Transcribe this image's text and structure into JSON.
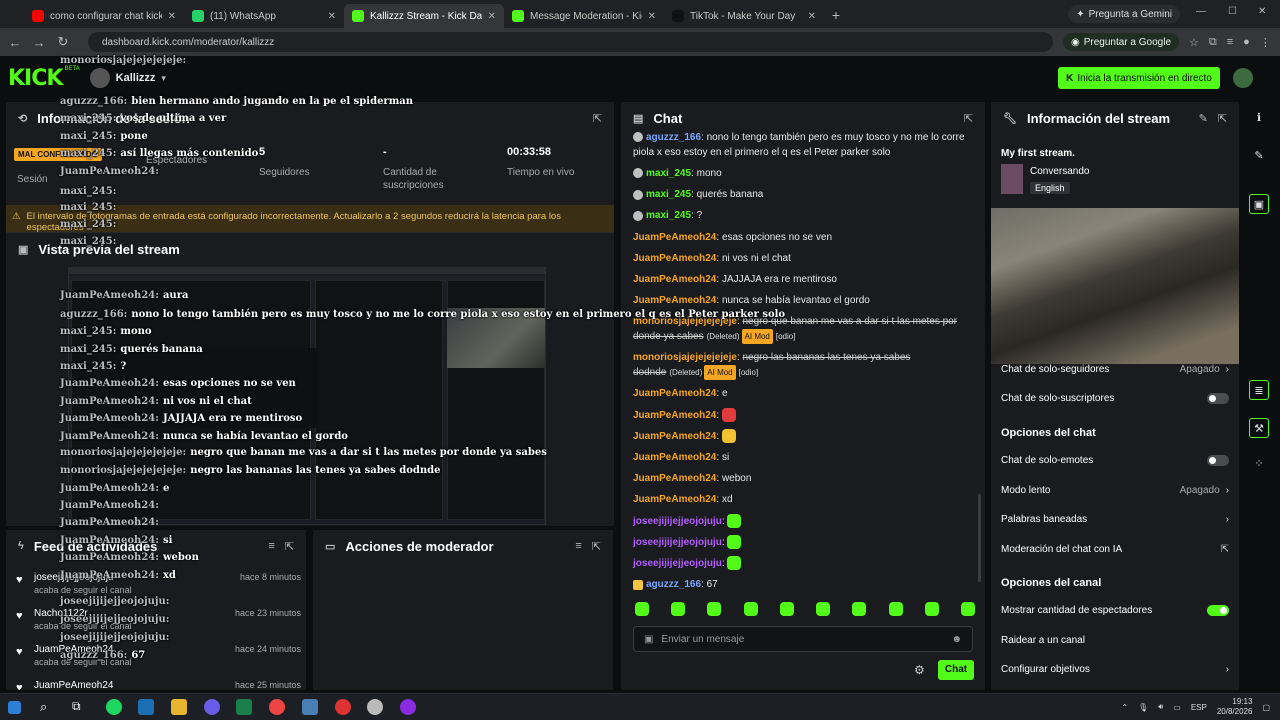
{
  "browser": {
    "tabs": [
      {
        "title": "como configurar chat kick para",
        "color": "#ff0000"
      },
      {
        "title": "(11) WhatsApp",
        "color": "#25d366"
      },
      {
        "title": "Kallizzz Stream - Kick Dashboa",
        "color": "#53fc18",
        "active": true
      },
      {
        "title": "Message Moderation - Kick Da",
        "color": "#53fc18"
      },
      {
        "title": "TikTok - Make Your Day",
        "color": "#111111"
      }
    ],
    "gemini": "Pregunta a Gemini",
    "url": "dashboard.kick.com/moderator/kallizzz",
    "ask_google": "Preguntar a Google"
  },
  "kick": {
    "logo": "KICK",
    "beta": "BETA",
    "username": "Kallizzz",
    "golive": "Inicia la transmisión en directo",
    "brand_color": "#53fc18"
  },
  "session": {
    "title": "Información de la sesión",
    "badge": "MAL CONFIGURADO",
    "label": "Sesión",
    "stats": [
      {
        "value": "",
        "label": "Espectadores"
      },
      {
        "value": "5",
        "label": "Seguidores"
      },
      {
        "value": "-",
        "label": "Cantidad de suscripciones"
      },
      {
        "value": "00:33:58",
        "label": "Tiempo en vivo"
      }
    ],
    "warning": "El intervalo de fotogramas de entrada está configurado incorrectamente. Actualizarlo a 2 segundos reducirá la latencia para los espectadores"
  },
  "preview": {
    "title": "Vista previa del stream"
  },
  "feed": {
    "title": "Feed de actividades",
    "items": [
      {
        "name": "joseejijijejjeojojuju",
        "action": "acaba de seguir el canal",
        "time": "hace 8 minutos"
      },
      {
        "name": "Nacho1122r",
        "action": "acaba de seguir el canal",
        "time": "hace 23 minutos"
      },
      {
        "name": "JuamPeAmeoh24",
        "action": "acaba de seguir el canal",
        "time": "hace 24 minutos"
      },
      {
        "name": "JuamPeAmeoh24",
        "action": "",
        "time": "hace 25 minutos"
      }
    ]
  },
  "mod": {
    "title": "Acciones de moderador"
  },
  "chat": {
    "title": "Chat",
    "messages": [
      {
        "user": "aguzzz_166",
        "color": "#7aa7ff",
        "text": "nono lo tengo también pero es muy tosco y no me lo corre piola x eso estoy en el primero el q es el Peter parker solo",
        "icon": "circ"
      },
      {
        "user": "maxi_245",
        "color": "#53fc18",
        "text": "mono",
        "icon": "circ"
      },
      {
        "user": "maxi_245",
        "color": "#53fc18",
        "text": "querés banana",
        "icon": "circ"
      },
      {
        "user": "maxi_245",
        "color": "#53fc18",
        "text": "?",
        "icon": "circ"
      },
      {
        "user": "JuamPeAmeoh24",
        "color": "#f5a623",
        "text": "esas opciones no se ven"
      },
      {
        "user": "JuamPeAmeoh24",
        "color": "#f5a623",
        "text": "ni vos ni el chat"
      },
      {
        "user": "JuamPeAmeoh24",
        "color": "#f5a623",
        "text": "JAJJAJA era re mentiroso"
      },
      {
        "user": "JuamPeAmeoh24",
        "color": "#f5a623",
        "text": "nunca se había levantao el gordo"
      },
      {
        "user": "monoriosjajejejejejeje",
        "color": "#f5a623",
        "text": "negro que banan me vas a dar si t las metes por donde ya sabes",
        "deleted": "(Deleted)",
        "mod": "AI Mod",
        "tag": "[odio]"
      },
      {
        "user": "monoriosjajejejejejeje",
        "color": "#f5a623",
        "text": "negro las bananas las tenes ya sabes dodnde",
        "deleted": "(Deleted)",
        "mod": "AI Mod",
        "tag": "[odio]"
      },
      {
        "user": "JuamPeAmeoh24",
        "color": "#f5a623",
        "text": "e"
      },
      {
        "user": "JuamPeAmeoh24",
        "color": "#f5a623",
        "text": "",
        "emote": "red"
      },
      {
        "user": "JuamPeAmeoh24",
        "color": "#f5a623",
        "text": "",
        "emote": "yellow"
      },
      {
        "user": "JuamPeAmeoh24",
        "color": "#f5a623",
        "text": "si"
      },
      {
        "user": "JuamPeAmeoh24",
        "color": "#f5a623",
        "text": "webon"
      },
      {
        "user": "JuamPeAmeoh24",
        "color": "#f5a623",
        "text": "xd"
      },
      {
        "user": "joseejijijejjeojojuju",
        "color": "#b45cff",
        "text": "",
        "emote": "green"
      },
      {
        "user": "joseejijijejjeojojuju",
        "color": "#b45cff",
        "text": "",
        "emote": "green"
      },
      {
        "user": "joseejijijejjeojojuju",
        "color": "#b45cff",
        "text": "",
        "emote": "green"
      },
      {
        "user": "aguzzz_166",
        "color": "#7aa7ff",
        "text": "67",
        "icon": "sq"
      }
    ],
    "input_placeholder": "Enviar un mensaje",
    "send": "Chat"
  },
  "stream_info": {
    "title": "Información del stream",
    "stream_title": "My first stream.",
    "category": "Conversando",
    "language": "English",
    "rows": [
      {
        "label": "Chat de solo-seguidores",
        "value": "Apagado",
        "kind": "chevron"
      },
      {
        "label": "Chat de solo-suscriptores",
        "kind": "toggle",
        "on": false
      }
    ],
    "chat_options_title": "Opciones del chat",
    "chat_options": [
      {
        "label": "Chat de solo-emotes",
        "kind": "toggle",
        "on": false
      },
      {
        "label": "Modo lento",
        "value": "Apagado",
        "kind": "chevron"
      },
      {
        "label": "Palabras baneadas",
        "kind": "chevron"
      },
      {
        "label": "Moderación del chat con IA",
        "kind": "external"
      }
    ],
    "channel_options_title": "Opciones del canal",
    "channel_options": [
      {
        "label": "Mostrar cantidad de espectadores",
        "kind": "toggle",
        "on": true
      },
      {
        "label": "Raidear a un canal",
        "kind": "none"
      },
      {
        "label": "Configurar objetivos",
        "kind": "chevron"
      }
    ]
  },
  "overlay": [
    {
      "user": "monoriosjajejejejejeje:",
      "text": ""
    },
    {
      "user": "aguzzz_166:",
      "text": "bien hermano ando jugando en la pe el spiderman"
    },
    {
      "user": "maxi_245:",
      "text": "vos de ultima a ver"
    },
    {
      "user": "maxi_245:",
      "text": "pone"
    },
    {
      "user": "maxi_245:",
      "text": "así llegas más contenido"
    },
    {
      "user": "JuamPeAmeoh24:",
      "text": ""
    },
    {
      "user": "maxi_245:",
      "text": ""
    },
    {
      "user": "maxi_245:",
      "text": ""
    },
    {
      "user": "maxi_245:",
      "text": ""
    },
    {
      "user": "maxi_245:",
      "text": ""
    },
    {
      "user": "JuamPeAmeoh24:",
      "text": "aura"
    },
    {
      "user": "aguzzz_166:",
      "text": "nono lo tengo también pero es muy tosco y no me lo corre piola x eso estoy en el primero el q es el Peter parker solo"
    },
    {
      "user": "maxi_245:",
      "text": "mono"
    },
    {
      "user": "maxi_245:",
      "text": "querés banana"
    },
    {
      "user": "maxi_245:",
      "text": "?"
    },
    {
      "user": "JuamPeAmeoh24:",
      "text": "esas opciones no se ven"
    },
    {
      "user": "JuamPeAmeoh24:",
      "text": "ni vos ni el chat"
    },
    {
      "user": "JuamPeAmeoh24:",
      "text": "JAJJAJA era re mentiroso"
    },
    {
      "user": "JuamPeAmeoh24:",
      "text": "nunca se había levantao el gordo"
    },
    {
      "user": "monoriosjajejejejejeje:",
      "text": "negro que banan me vas a dar si t las metes por donde ya sabes"
    },
    {
      "user": "monoriosjajejejejejeje:",
      "text": "negro las bananas las tenes ya sabes dodnde"
    },
    {
      "user": "JuamPeAmeoh24:",
      "text": "e"
    },
    {
      "user": "JuamPeAmeoh24:",
      "text": ""
    },
    {
      "user": "JuamPeAmeoh24:",
      "text": ""
    },
    {
      "user": "JuamPeAmeoh24:",
      "text": "si"
    },
    {
      "user": "JuamPeAmeoh24:",
      "text": "webon"
    },
    {
      "user": "JuamPeAmeoh24:",
      "text": "xd"
    },
    {
      "user": "joseejijijejjeojojuju:",
      "text": ""
    },
    {
      "user": "joseejijijejjeojojuju:",
      "text": ""
    },
    {
      "user": "joseejijijejjeojojuju:",
      "text": ""
    },
    {
      "user": "aguzzz_166:",
      "text": "67"
    }
  ],
  "taskbar": {
    "lang": "ESP",
    "time": "19:13",
    "date": "20/8/2026"
  }
}
